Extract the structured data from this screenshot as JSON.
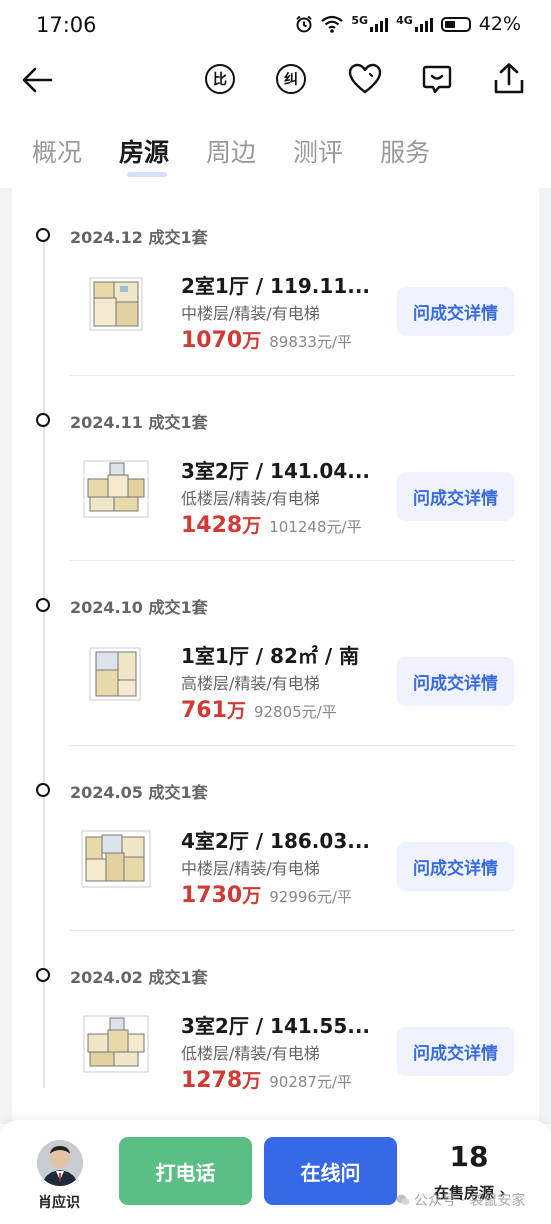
{
  "status_bar": {
    "time": "17:06",
    "network_5g": "5G",
    "network_4g": "4G",
    "battery_percent": "42%"
  },
  "header": {
    "icons": [
      "back-arrow-icon",
      "compare-icon",
      "correction-icon",
      "favorite-heart-icon",
      "chat-bubble-icon",
      "share-icon"
    ],
    "compare_label": "比",
    "correction_label": "纠"
  },
  "tabs": [
    {
      "label": "概况",
      "active": false
    },
    {
      "label": "房源",
      "active": true
    },
    {
      "label": "周边",
      "active": false
    },
    {
      "label": "测评",
      "active": false
    },
    {
      "label": "服务",
      "active": false
    }
  ],
  "transactions": [
    {
      "date": "2024.12 成交1套",
      "layout": "2室1厅 / 119.11...",
      "tags": "中楼层/精装/有电梯",
      "total": "1070",
      "unit": "万",
      "unit_price": "89833元/平",
      "action": "问成交详情"
    },
    {
      "date": "2024.11 成交1套",
      "layout": "3室2厅 / 141.04...",
      "tags": "低楼层/精装/有电梯",
      "total": "1428",
      "unit": "万",
      "unit_price": "101248元/平",
      "action": "问成交详情"
    },
    {
      "date": "2024.10 成交1套",
      "layout": "1室1厅 / 82㎡ / 南",
      "tags": "高楼层/精装/有电梯",
      "total": "761",
      "unit": "万",
      "unit_price": "92805元/平",
      "action": "问成交详情"
    },
    {
      "date": "2024.05 成交1套",
      "layout": "4室2厅 / 186.03...",
      "tags": "中楼层/精装/有电梯",
      "total": "1730",
      "unit": "万",
      "unit_price": "92996元/平",
      "action": "问成交详情"
    },
    {
      "date": "2024.02 成交1套",
      "layout": "3室2厅 / 141.55...",
      "tags": "低楼层/精装/有电梯",
      "total": "1278",
      "unit": "万",
      "unit_price": "90287元/平",
      "action": "问成交详情"
    }
  ],
  "bottom_bar": {
    "agent_name": "肖应识",
    "call_label": "打电话",
    "online_label": "在线问",
    "listing_count": "18",
    "listing_label": "在售房源 ›"
  },
  "watermark": "公众号 · 袋鼠安家",
  "colors": {
    "price_red": "#d13a35",
    "action_blue": "#3a6bdc",
    "call_green": "#5bbf85",
    "online_blue": "#3569e6"
  }
}
